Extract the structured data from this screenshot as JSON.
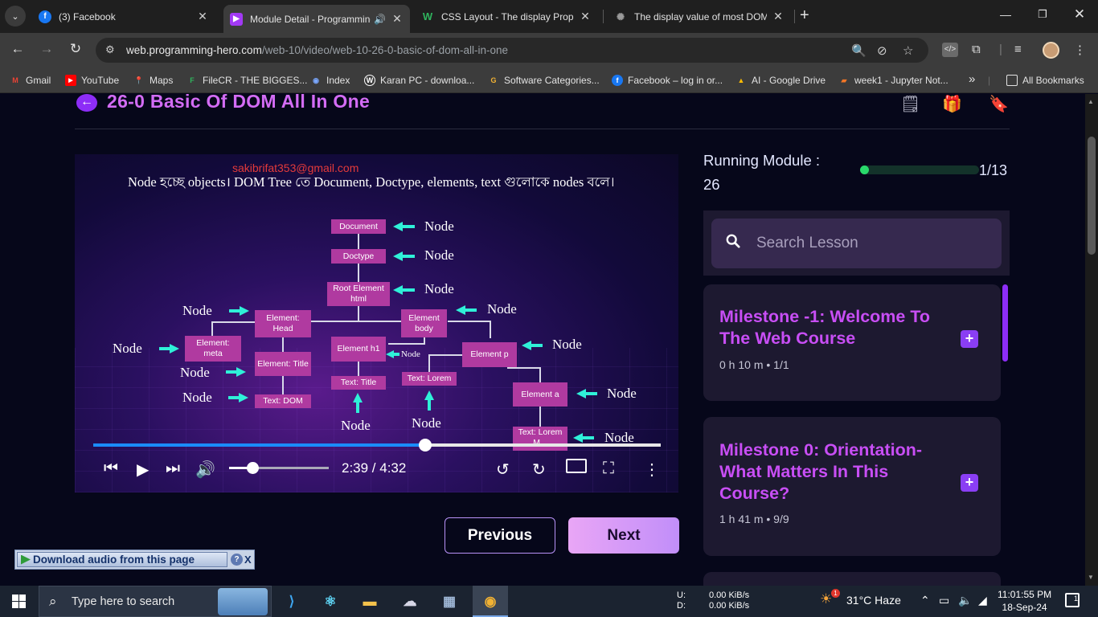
{
  "browser": {
    "tabs": [
      {
        "title": "(3) Facebook",
        "icon": "facebook-icon",
        "active": false
      },
      {
        "title": "Module Detail - Programming Hero",
        "icon": "programming-hero-icon",
        "active": true
      },
      {
        "title": "CSS Layout - The display Property",
        "icon": "w3schools-icon",
        "active": false
      },
      {
        "title": "The display value of most DOM",
        "icon": "generic-icon",
        "active": false
      }
    ],
    "url_host": "web.programming-hero.com",
    "url_path": "/web-10/video/web-10-26-0-basic-of-dom-all-in-one",
    "bookmarks": [
      {
        "label": "Gmail",
        "color": "#ea4335"
      },
      {
        "label": "YouTube",
        "color": "#ff0000"
      },
      {
        "label": "Maps",
        "color": "#34a853"
      },
      {
        "label": "FileCR - THE BIGGES...",
        "color": "#2fb35d"
      },
      {
        "label": "Index",
        "color": "#7aa7ff"
      },
      {
        "label": "Karan PC - downloa...",
        "color": "#ffffff"
      },
      {
        "label": "Software Categories...",
        "color": "#f2b233"
      },
      {
        "label": "Facebook – log in or...",
        "color": "#1877f2"
      },
      {
        "label": "AI - Google Drive",
        "color": "#fbbc04"
      },
      {
        "label": "week1 - Jupyter Not...",
        "color": "#f37626"
      }
    ],
    "bookmarks_overflow": "»",
    "all_bookmarks": "All Bookmarks"
  },
  "lesson": {
    "title": "26-0 Basic Of DOM All In One"
  },
  "video": {
    "watermark": "sakibrifat353@gmail.com",
    "slide_heading": "Node হচ্ছে objects। DOM Tree তে  Document, Doctype, elements, text গুলোকে nodes বলে।",
    "nodes": {
      "document": "Document",
      "doctype": "Doctype",
      "root": "Root Element html",
      "head": "Element: Head",
      "body": "Element body",
      "meta": "Element: meta",
      "title": "Element: Title",
      "text_dom": "Text: DOM",
      "h1": "Element h1",
      "text_title": "Text: Title",
      "text_lorem": "Text: Lorem",
      "p": "Element p",
      "a": "Element a",
      "text_a": "Text: Lorem M..."
    },
    "node_label": "Node",
    "time": "2:39 / 4:32",
    "progress_percent": 58.5,
    "volume_percent": 23
  },
  "nav": {
    "previous": "Previous",
    "next": "Next"
  },
  "extension": {
    "download_label": "Download audio from this page",
    "help": "?",
    "close": "X"
  },
  "sidebar": {
    "running_label": "Running Module :",
    "running_value": "26",
    "module_count": "1/13",
    "module_progress_fraction": 0.077,
    "search_placeholder": "Search Lesson",
    "milestones": [
      {
        "title": "Milestone -1: Welcome To The Web Course",
        "meta": "0 h 10 m  •  1/1"
      },
      {
        "title": "Milestone 0: Orientation- What Matters In This Course?",
        "meta": "1 h 41 m  •  9/9"
      }
    ]
  },
  "taskbar": {
    "search_placeholder": "Type here to search",
    "net_up_label": "U:",
    "net_down_label": "D:",
    "net_up": "0.00 KiB/s",
    "net_down": "0.00 KiB/s",
    "weather": "31°C  Haze",
    "weather_badge": "1",
    "time": "11:01:55 PM",
    "date": "18-Sep-24",
    "notifications": "1"
  }
}
